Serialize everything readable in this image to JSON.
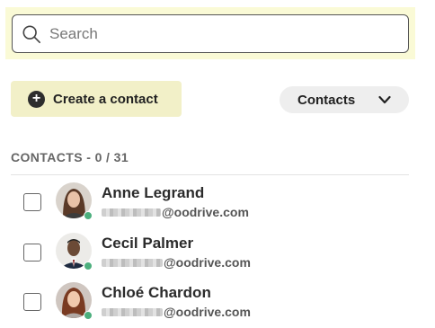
{
  "search": {
    "placeholder": "Search"
  },
  "actions": {
    "create_label": "Create a contact",
    "filter_label": "Contacts"
  },
  "section": {
    "title": "CONTACTS - 0 / 31"
  },
  "contacts": [
    {
      "name": "Anne Legrand",
      "email_domain": "@oodrive.com",
      "status": "online"
    },
    {
      "name": "Cecil Palmer",
      "email_domain": "@oodrive.com",
      "status": "online"
    },
    {
      "name": "Chloé Chardon",
      "email_domain": "@oodrive.com",
      "status": "online"
    }
  ],
  "colors": {
    "accent_bg": "#f2f0c8",
    "search_highlight": "#fafad6",
    "status_online": "#4caf7d"
  }
}
